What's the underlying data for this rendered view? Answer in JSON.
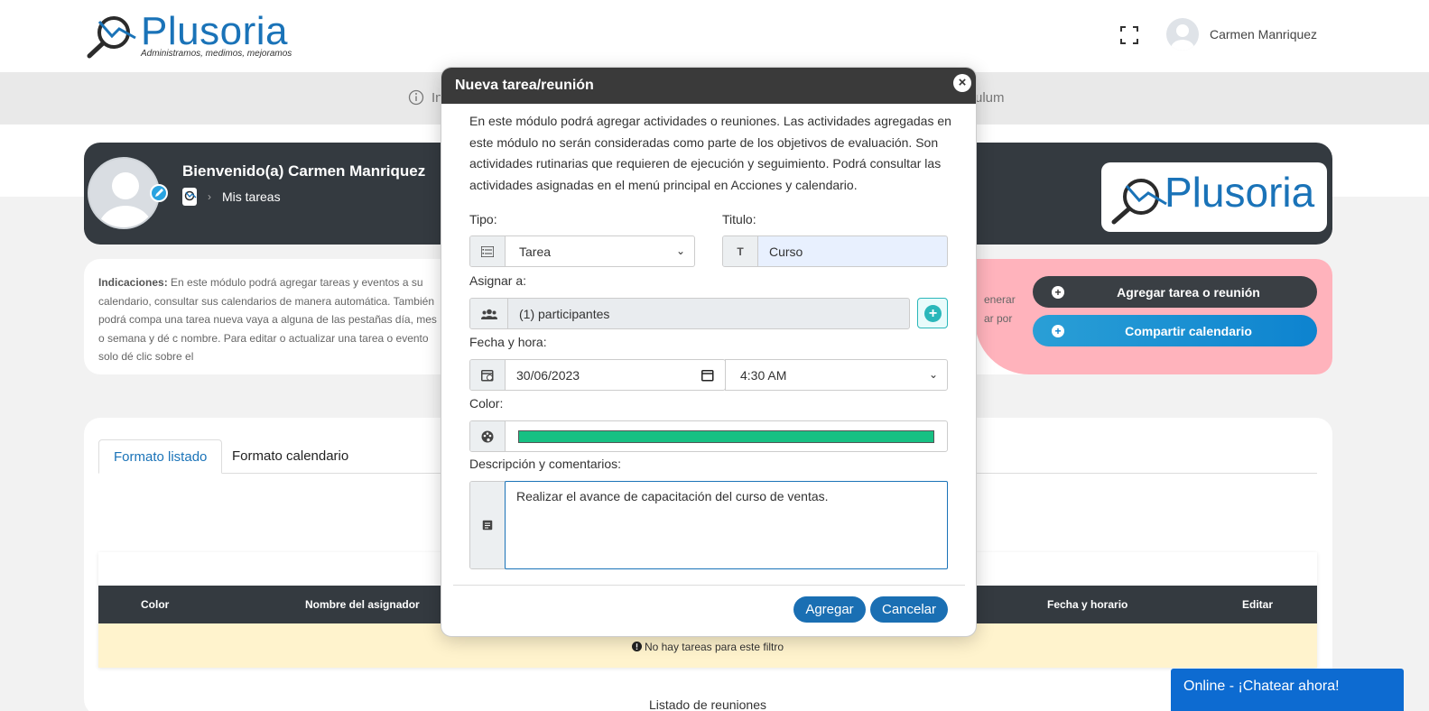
{
  "header": {
    "logo_text": "Plusoria",
    "logo_tagline": "Administramos, medimos, mejoramos",
    "fullscreen_icon": "expand-icon",
    "user_name": "Carmen Manriquez"
  },
  "infobar": {
    "text_left": "In",
    "text_right": "ulum"
  },
  "profile": {
    "welcome": "Bienvenido(a) Carmen Manriquez",
    "breadcrumb": "Mis tareas",
    "logo_text": "Plusoria"
  },
  "indications": {
    "label": "Indicaciones:",
    "text": " En este módulo podrá agregar tareas y eventos a su calendario, consultar sus calendarios de manera automática. También podrá compa una tarea nueva vaya a alguna de las pestañas día, mes o semana y dé c nombre. Para editar o actualizar una tarea o evento solo dé clic sobre el",
    "right_fragment_1": "enerar",
    "right_fragment_2": "ar por",
    "add_button": "Agregar tarea o reunión",
    "share_button": "Compartir calendario"
  },
  "tabs": [
    "Formato listado",
    "Formato calendario"
  ],
  "table": {
    "columns": [
      "Color",
      "Nombre del asignador",
      "Fecha y horario",
      "Editar"
    ],
    "empty_message": "No hay tareas para este filtro",
    "next_section": "Listado de reuniones"
  },
  "chat": {
    "label": "Online - ¡Chatear ahora!"
  },
  "modal": {
    "title": "Nueva tarea/reunión",
    "description": "En este módulo podrá agregar actividades o reuniones. Las actividades agregadas en este módulo no serán consideradas como parte de los objetivos de evaluación. Son actividades rutinarias que requieren de ejecución y seguimiento. Podrá consultar las actividades asignadas en el menú principal en Acciones y calendario.",
    "tipo_label": "Tipo:",
    "tipo_value": "Tarea",
    "titulo_label": "Titulo:",
    "titulo_value": "Curso",
    "asignar_label": "Asignar a:",
    "asignar_value": "(1) participantes",
    "fecha_label": "Fecha y hora:",
    "date_value": "30/06/2023",
    "time_value": "4:30 AM",
    "color_label": "Color:",
    "color_value": "#17c083",
    "desc_label": "Descripción y comentarios:",
    "desc_value": "Realizar el avance de capacitación del curso de ventas.",
    "add_button": "Agregar",
    "cancel_button": "Cancelar"
  },
  "colors": {
    "accent": "#1a73b8",
    "dark": "#343a40",
    "chat": "#0d6bd1"
  }
}
